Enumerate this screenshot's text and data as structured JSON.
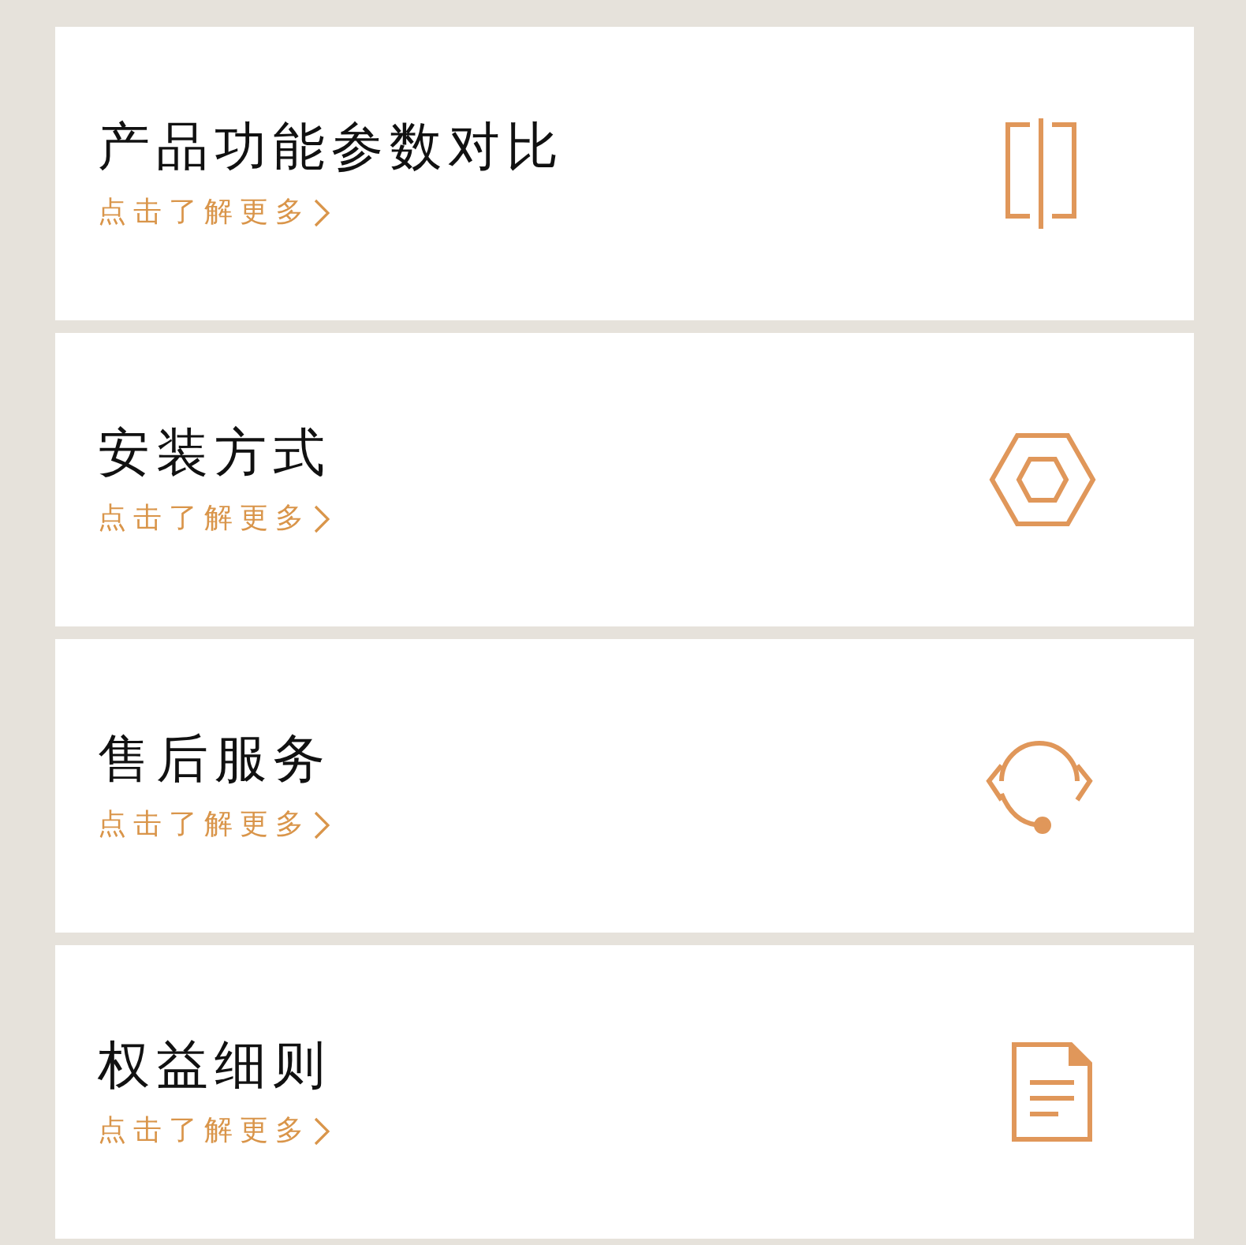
{
  "cards": [
    {
      "kind": "compare",
      "title": "产品功能参数对比",
      "link": "点击了解更多"
    },
    {
      "kind": "install",
      "title": "安装方式",
      "link": "点击了解更多"
    },
    {
      "kind": "service",
      "title": "售后服务",
      "link": "点击了解更多"
    },
    {
      "kind": "rights",
      "title": "权益细则",
      "link": "点击了解更多"
    }
  ]
}
